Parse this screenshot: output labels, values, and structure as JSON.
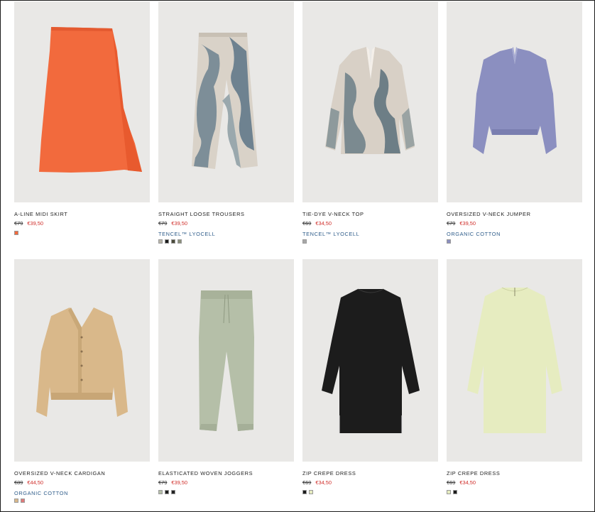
{
  "products": [
    {
      "name": "A-LINE MIDI SKIRT",
      "old_price": "€79",
      "sale_price": "€39,50",
      "material": "",
      "swatches": [
        "#f26a3d"
      ]
    },
    {
      "name": "STRAIGHT LOOSE TROUSERS",
      "old_price": "€79",
      "sale_price": "€39,50",
      "material": "TENCEL™ LYOCELL",
      "swatches": [
        "#b8b4a8",
        "#1c1c1c",
        "#4a4a3a",
        "#8a8f7a"
      ]
    },
    {
      "name": "TIE-DYE V-NECK TOP",
      "old_price": "€69",
      "sale_price": "€34,50",
      "material": "TENCEL™ LYOCELL",
      "swatches": [
        "#a8a8a8"
      ]
    },
    {
      "name": "OVERSIZED V-NECK JUMPER",
      "old_price": "€79",
      "sale_price": "€39,50",
      "material": "ORGANIC COTTON",
      "swatches": [
        "#8b8fc0"
      ]
    },
    {
      "name": "OVERSIZED V-NECK CARDIGAN",
      "old_price": "€89",
      "sale_price": "€44,50",
      "material": "ORGANIC COTTON",
      "swatches": [
        "#d9b88a",
        "#e07a7a"
      ]
    },
    {
      "name": "ELASTICATED WOVEN JOGGERS",
      "old_price": "€79",
      "sale_price": "€39,50",
      "material": "",
      "swatches": [
        "#b5bfa8",
        "#1c1c1c",
        "#222222"
      ]
    },
    {
      "name": "ZIP CREPE DRESS",
      "old_price": "€69",
      "sale_price": "€34,50",
      "material": "",
      "swatches": [
        "#1c1c1c",
        "#e6ecc0"
      ]
    },
    {
      "name": "ZIP CREPE DRESS",
      "old_price": "€69",
      "sale_price": "€34,50",
      "material": "",
      "swatches": [
        "#e6ecc0",
        "#1c1c1c"
      ]
    }
  ],
  "colors": {
    "sale": "#d0302c",
    "material_link": "#2e5c8a",
    "photo_bg": "#e9e8e6"
  }
}
